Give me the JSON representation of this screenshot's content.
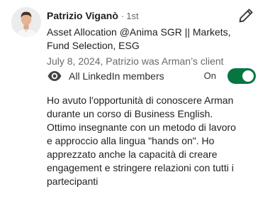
{
  "recommendation": {
    "name": "Patrizio Viganò",
    "degree_separator": "·",
    "degree": "1st",
    "headline": "Asset Allocation @Anima SGR || Markets, Fund Selection, ESG",
    "meta": "July 8, 2024, Patrizio was Arman’s client",
    "visibility_label": "All LinkedIn members",
    "toggle_state_label": "On",
    "toggle_on": true,
    "text": "Ho avuto l'opportunità di conoscere Arman durante un corso di Business English. Ottimo insegnante con un metodo di lavoro e approccio alla lingua \"hands on\". Ho apprezzato anche la capacità di creare engagement e stringere relazioni con tutti i partecipanti"
  },
  "icons": {
    "edit": "pencil-icon",
    "visibility": "eye-icon"
  },
  "colors": {
    "toggle_on": "#057642",
    "meta_text": "#6a6a6a"
  }
}
